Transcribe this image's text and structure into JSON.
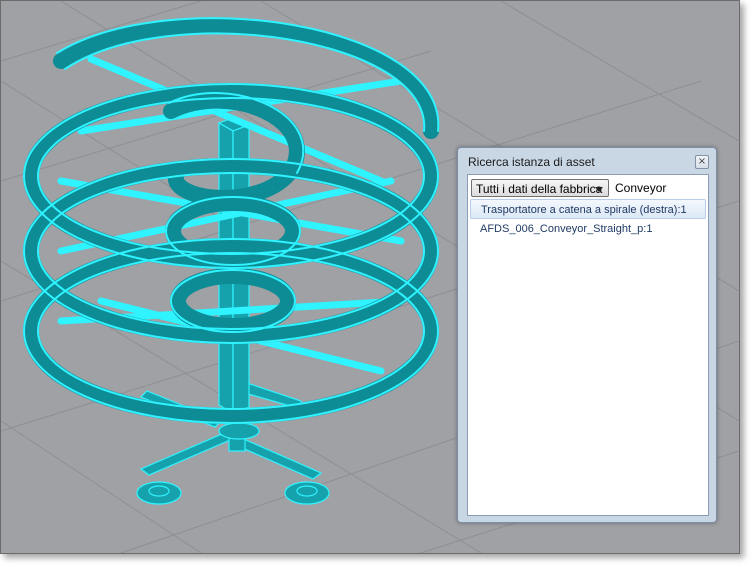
{
  "panel": {
    "title": "Ricerca istanza di asset",
    "close_icon": "close-icon",
    "scope_dropdown": {
      "selected": "Tutti i dati della fabbrica"
    },
    "search": {
      "value": "Conveyor"
    },
    "results": [
      {
        "label": "Trasportatore a catena a spirale (destra):1",
        "selected": true
      },
      {
        "label": "AFDS_006_Conveyor_Straight_p:1",
        "selected": false
      }
    ]
  },
  "colors": {
    "viewport_bg": "#9fa1a5",
    "model_fill": "#16a2ac",
    "model_edge": "#2ff3ff",
    "panel_bg": "#c9d6e4"
  }
}
